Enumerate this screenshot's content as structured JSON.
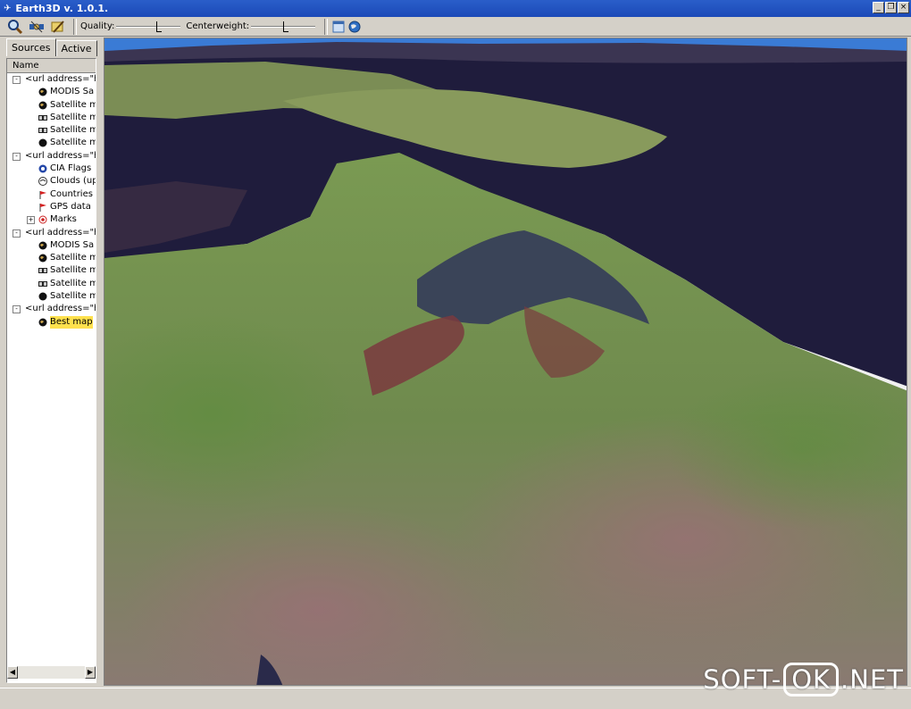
{
  "window": {
    "title": "Earth3D v. 1.0.1."
  },
  "toolbar": {
    "quality_label": "Quality:",
    "quality_value": 0.67,
    "centerweight_label": "Centerweight:",
    "centerweight_value": 0.55
  },
  "panel": {
    "tabs": [
      {
        "label": "Sources"
      },
      {
        "label": "Active"
      }
    ],
    "column_header": "Name",
    "tree": [
      {
        "label": "<url address=\"ht",
        "level": 0,
        "expander": "-",
        "icon": "none"
      },
      {
        "label": "MODIS Sa",
        "level": 1,
        "icon": "globe-icon"
      },
      {
        "label": "Satellite m",
        "level": 1,
        "icon": "globe-icon"
      },
      {
        "label": "Satellite m",
        "level": 1,
        "icon": "map-strip-icon"
      },
      {
        "label": "Satellite m",
        "level": 1,
        "icon": "map-strip-icon"
      },
      {
        "label": "Satellite m",
        "level": 1,
        "icon": "globe-dark-icon"
      },
      {
        "label": "<url address=\"ht",
        "level": 0,
        "expander": "-",
        "icon": "none"
      },
      {
        "label": "CIA Flags",
        "level": 1,
        "icon": "flags-globe-icon"
      },
      {
        "label": "Clouds (up",
        "level": 1,
        "icon": "clouds-icon"
      },
      {
        "label": "Countries",
        "level": 1,
        "icon": "flag-red-icon"
      },
      {
        "label": "GPS data",
        "level": 1,
        "icon": "flag-red-icon"
      },
      {
        "label": "Marks",
        "level": 1,
        "expander": "+",
        "icon": "mark-icon"
      },
      {
        "label": "<url address=\"ht",
        "level": 0,
        "expander": "-",
        "icon": "none"
      },
      {
        "label": "MODIS Sa",
        "level": 1,
        "icon": "globe-icon"
      },
      {
        "label": "Satellite m",
        "level": 1,
        "icon": "globe-icon"
      },
      {
        "label": "Satellite m",
        "level": 1,
        "icon": "map-strip-icon"
      },
      {
        "label": "Satellite m",
        "level": 1,
        "icon": "map-strip-icon"
      },
      {
        "label": "Satellite m",
        "level": 1,
        "icon": "globe-dark-icon"
      },
      {
        "label": "<url address=\"ht",
        "level": 0,
        "expander": "-",
        "icon": "none"
      },
      {
        "label": "Best map",
        "level": 1,
        "icon": "globe-icon",
        "selected": true
      }
    ]
  },
  "watermark": {
    "left": "SOFT-",
    "boxed": "OK",
    "right": ".NET"
  },
  "colors": {
    "titlebar": "#1b49b8",
    "selection": "#ffe14d",
    "sea": "#1f1c3c",
    "land": "#6d8a4a"
  }
}
